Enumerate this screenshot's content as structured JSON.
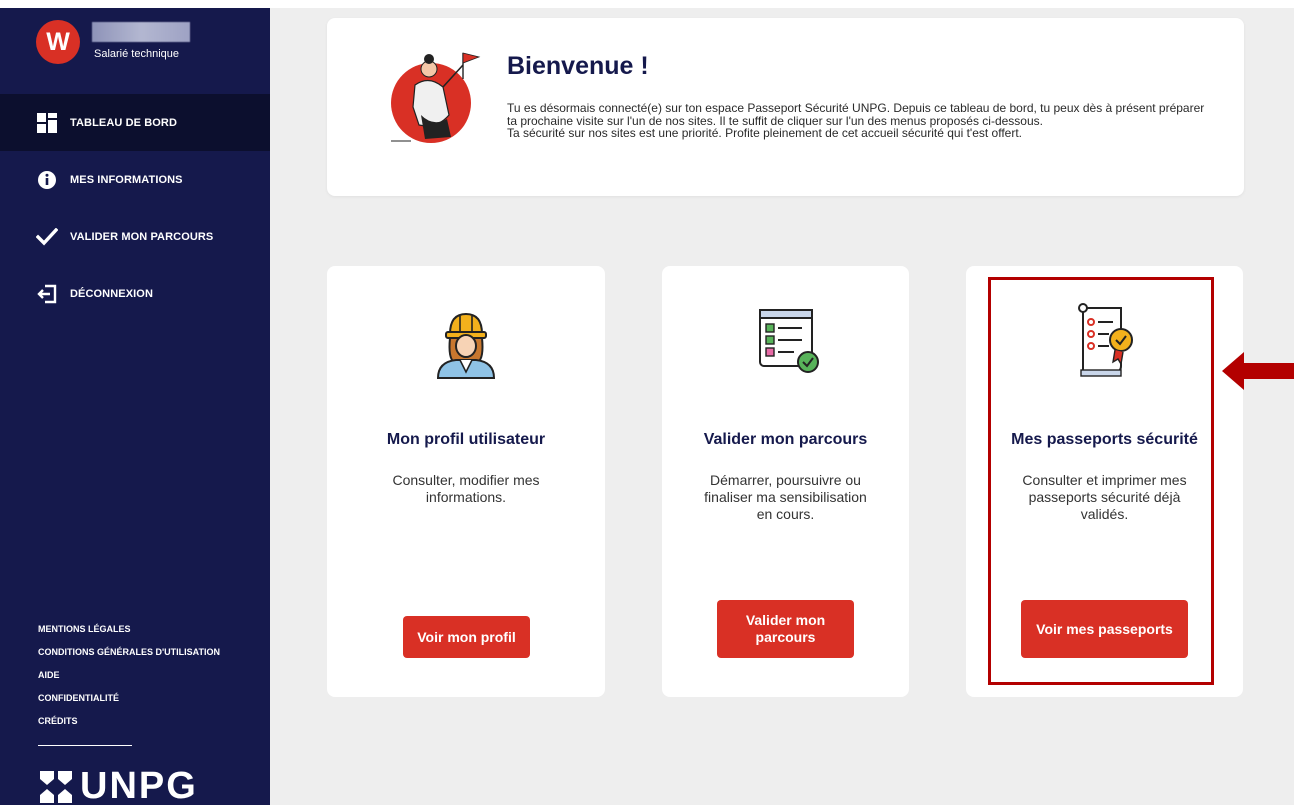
{
  "sidebar": {
    "avatar_letter": "W",
    "role": "Salarié technique",
    "nav": [
      {
        "label": "TABLEAU DE BORD",
        "icon": "dashboard-icon",
        "active": true
      },
      {
        "label": "MES INFORMATIONS",
        "icon": "info-icon"
      },
      {
        "label": "VALIDER MON PARCOURS",
        "icon": "check-icon"
      },
      {
        "label": "DÉCONNEXION",
        "icon": "logout-icon"
      }
    ],
    "footer_links": [
      "MENTIONS LÉGALES",
      "CONDITIONS GÉNÉRALES D'UTILISATION",
      "AIDE",
      "CONFIDENTIALITÉ",
      "CRÉDITS"
    ],
    "logo_text": "UNPG"
  },
  "welcome": {
    "title": "Bienvenue          !",
    "text": "Tu es désormais connecté(e) sur ton espace Passeport Sécurité UNPG. Depuis ce tableau de bord, tu peux dès à présent préparer ta prochaine visite sur l'un de nos sites. Il te suffit de cliquer sur l'un des menus proposés ci-dessous.",
    "text2": "Ta sécurité sur nos sites est une priorité. Profite pleinement de cet accueil sécurité qui t'est offert."
  },
  "cards": [
    {
      "title": "Mon profil utilisateur",
      "description": "Consulter, modifier mes informations.",
      "button": "Voir mon profil",
      "icon": "worker-helmet-icon"
    },
    {
      "title": "Valider mon parcours",
      "description": "Démarrer, poursuivre ou finaliser ma sensibilisation en cours.",
      "button": "Valider mon parcours",
      "icon": "checklist-icon"
    },
    {
      "title": "Mes passeports sécurité",
      "description": "Consulter et imprimer mes passeports sécurité déjà validés.",
      "button": "Voir mes passeports",
      "icon": "certificate-scroll-icon"
    }
  ],
  "colors": {
    "sidebar_bg": "#15194c",
    "accent_red": "#d93025",
    "highlight_border": "#b30000",
    "main_bg": "#eeeeee"
  }
}
